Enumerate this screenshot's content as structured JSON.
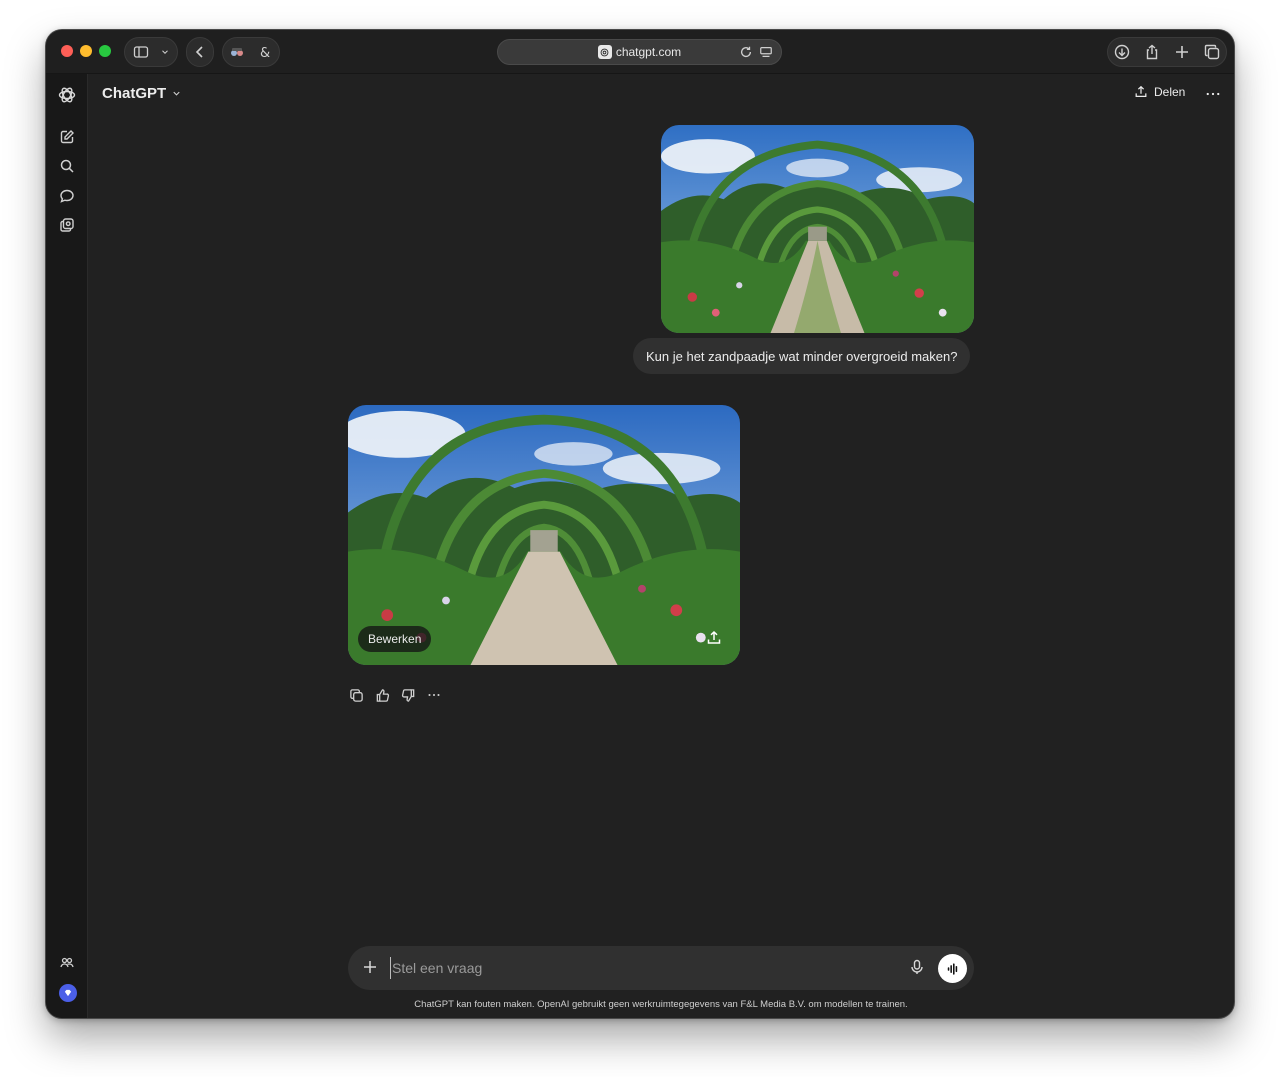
{
  "browser": {
    "url": "chatgpt.com"
  },
  "app": {
    "title": "ChatGPT",
    "share_label": "Delen"
  },
  "conversation": {
    "user_message": "Kun je het zandpaadje wat minder overgroeid maken?",
    "edit_label": "Bewerken"
  },
  "composer": {
    "placeholder": "Stel een vraag"
  },
  "footer": {
    "disclaimer": "ChatGPT kan fouten maken. OpenAI gebruikt geen werkruimtegegevens van F&L Media B.V. om modellen te trainen."
  },
  "colors": {
    "background": "#212121",
    "sidebar": "#181818",
    "bubble": "#303030",
    "accent": "#4b5fe8"
  },
  "icons": {
    "toolbar": [
      "sidebar-toggle-icon",
      "chevron-down-icon",
      "back-icon",
      "extension-icon",
      "ampersand-icon",
      "reload-icon",
      "reader-icon",
      "download-icon",
      "share-icon",
      "new-tab-icon",
      "tabs-icon"
    ],
    "sidebar": [
      "openai-logo-icon",
      "new-chat-icon",
      "search-icon",
      "chat-bubble-icon",
      "library-icon",
      "team-icon",
      "upgrade-icon"
    ],
    "actions": [
      "copy-icon",
      "thumbs-up-icon",
      "thumbs-down-icon",
      "more-icon"
    ]
  }
}
